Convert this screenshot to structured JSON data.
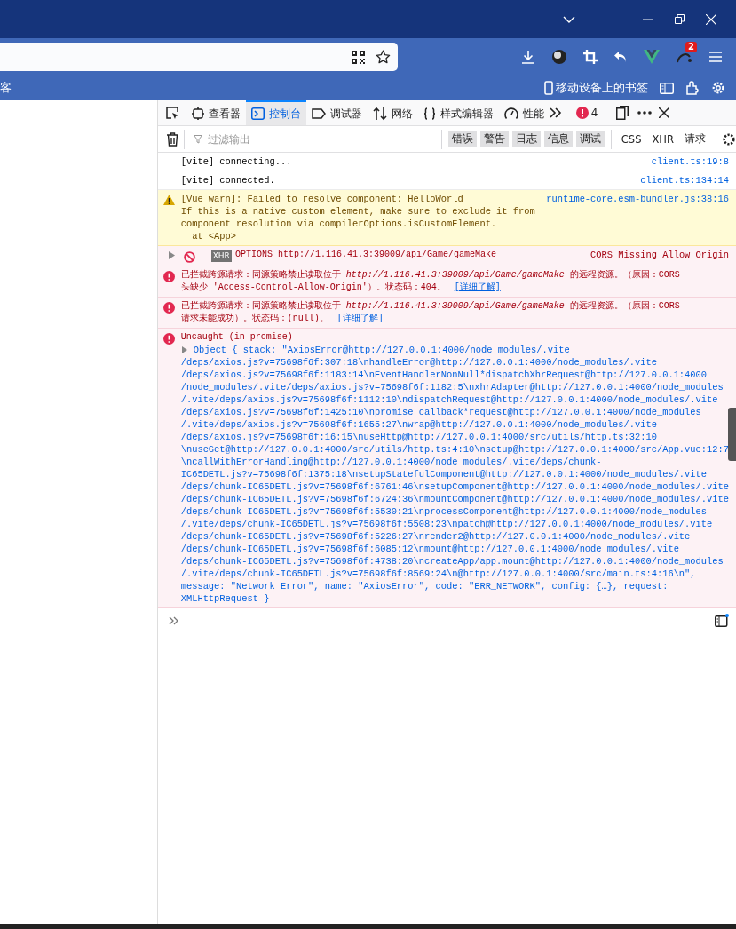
{
  "browser": {
    "bookmark_left": "客",
    "bookmark_mobile": "移动设备上的书签",
    "extension_badge": "2"
  },
  "devtools": {
    "tabs": [
      {
        "label": "查看器",
        "selected": false
      },
      {
        "label": "控制台",
        "selected": true
      },
      {
        "label": "调试器",
        "selected": false
      },
      {
        "label": "网络",
        "selected": false
      },
      {
        "label": "样式编辑器",
        "selected": false
      },
      {
        "label": "性能",
        "selected": false
      }
    ],
    "error_count": "4",
    "filter": {
      "placeholder": "过滤输出"
    },
    "levels": [
      {
        "label": "错误",
        "selected": true
      },
      {
        "label": "警告",
        "selected": true
      },
      {
        "label": "日志",
        "selected": true
      },
      {
        "label": "信息",
        "selected": true
      },
      {
        "label": "调试",
        "selected": true
      }
    ],
    "categories": [
      {
        "label": "CSS",
        "selected": false
      },
      {
        "label": "XHR",
        "selected": false
      },
      {
        "label": "请求",
        "selected": false
      }
    ]
  },
  "messages": [
    {
      "kind": "log",
      "lines": [
        "[vite] connecting..."
      ],
      "source": "client.ts:19:8"
    },
    {
      "kind": "log",
      "lines": [
        "[vite] connected."
      ],
      "source": "client.ts:134:14"
    },
    {
      "kind": "warn",
      "lines": [
        "[Vue warn]: Failed to resolve component: HelloWorld",
        "If this is a native custom element, make sure to exclude it from",
        "component resolution via compilerOptions.isCustomElement.",
        "  at <App>"
      ],
      "source": "runtime-core.esm-bundler.js:38:16"
    },
    {
      "kind": "network",
      "tag": "XHR",
      "lines": [
        "OPTIONS http://1.116.41.3:39009/api/Game/gameMake"
      ],
      "source": "CORS Missing Allow Origin"
    },
    {
      "kind": "error",
      "lines": [
        "已拦截跨源请求：同源策略禁止读取位于 *http://1.116.41.3:39009/api/Game/gameMake* 的远程资源。（原因：CORS",
        "头缺少 'Access-Control-Allow-Origin'）。状态码：404。"
      ],
      "link": "[详细了解]"
    },
    {
      "kind": "error",
      "lines": [
        "已拦截跨源请求：同源策略禁止读取位于 *http://1.116.41.3:39009/api/Game/gameMake* 的远程资源。（原因：CORS",
        "请求未能成功）。状态码：(null)。"
      ],
      "link": "[详细了解]"
    },
    {
      "kind": "uncaught",
      "lines": [
        "Uncaught (in promise)"
      ],
      "object_lines": [
        "Object { stack: \"AxiosError@http://127.0.0.1:4000/node_modules/.vite",
        "/deps/axios.js?v=75698f6f:307:18\\nhandleError@http://127.0.0.1:4000/node_modules/.vite",
        "/deps/axios.js?v=75698f6f:1183:14\\nEventHandlerNonNull*dispatchXhrRequest@http://127.0.0.1:4000",
        "/node_modules/.vite/deps/axios.js?v=75698f6f:1182:5\\nxhrAdapter@http://127.0.0.1:4000/node_modules",
        "/.vite/deps/axios.js?v=75698f6f:1112:10\\ndispatchRequest@http://127.0.0.1:4000/node_modules/.vite",
        "/deps/axios.js?v=75698f6f:1425:10\\npromise callback*request@http://127.0.0.1:4000/node_modules",
        "/.vite/deps/axios.js?v=75698f6f:1655:27\\nwrap@http://127.0.0.1:4000/node_modules/.vite",
        "/deps/axios.js?v=75698f6f:16:15\\nuseHttp@http://127.0.0.1:4000/src/utils/http.ts:32:10",
        "\\nuseGet@http://127.0.0.1:4000/src/utils/http.ts:4:10\\nsetup@http://127.0.0.1:4000/src/App.vue:12:7",
        "\\ncallWithErrorHandling@http://127.0.0.1:4000/node_modules/.vite/deps/chunk-",
        "IC65DETL.js?v=75698f6f:1375:18\\nsetupStatefulComponent@http://127.0.0.1:4000/node_modules/.vite",
        "/deps/chunk-IC65DETL.js?v=75698f6f:6761:46\\nsetupComponent@http://127.0.0.1:4000/node_modules/.vite",
        "/deps/chunk-IC65DETL.js?v=75698f6f:6724:36\\nmountComponent@http://127.0.0.1:4000/node_modules/.vite",
        "/deps/chunk-IC65DETL.js?v=75698f6f:5530:21\\nprocessComponent@http://127.0.0.1:4000/node_modules",
        "/.vite/deps/chunk-IC65DETL.js?v=75698f6f:5508:23\\npatch@http://127.0.0.1:4000/node_modules/.vite",
        "/deps/chunk-IC65DETL.js?v=75698f6f:5226:27\\nrender2@http://127.0.0.1:4000/node_modules/.vite",
        "/deps/chunk-IC65DETL.js?v=75698f6f:6085:12\\nmount@http://127.0.0.1:4000/node_modules/.vite",
        "/deps/chunk-IC65DETL.js?v=75698f6f:4738:20\\ncreateApp/app.mount@http://127.0.0.1:4000/node_modules",
        "/.vite/deps/chunk-IC65DETL.js?v=75698f6f:8569:24\\n@http://127.0.0.1:4000/src/main.ts:4:16\\n\",",
        "message: \"Network Error\", name: \"AxiosError\", code: \"ERR_NETWORK\", config: {…}, request:",
        "XMLHttpRequest }"
      ]
    }
  ]
}
